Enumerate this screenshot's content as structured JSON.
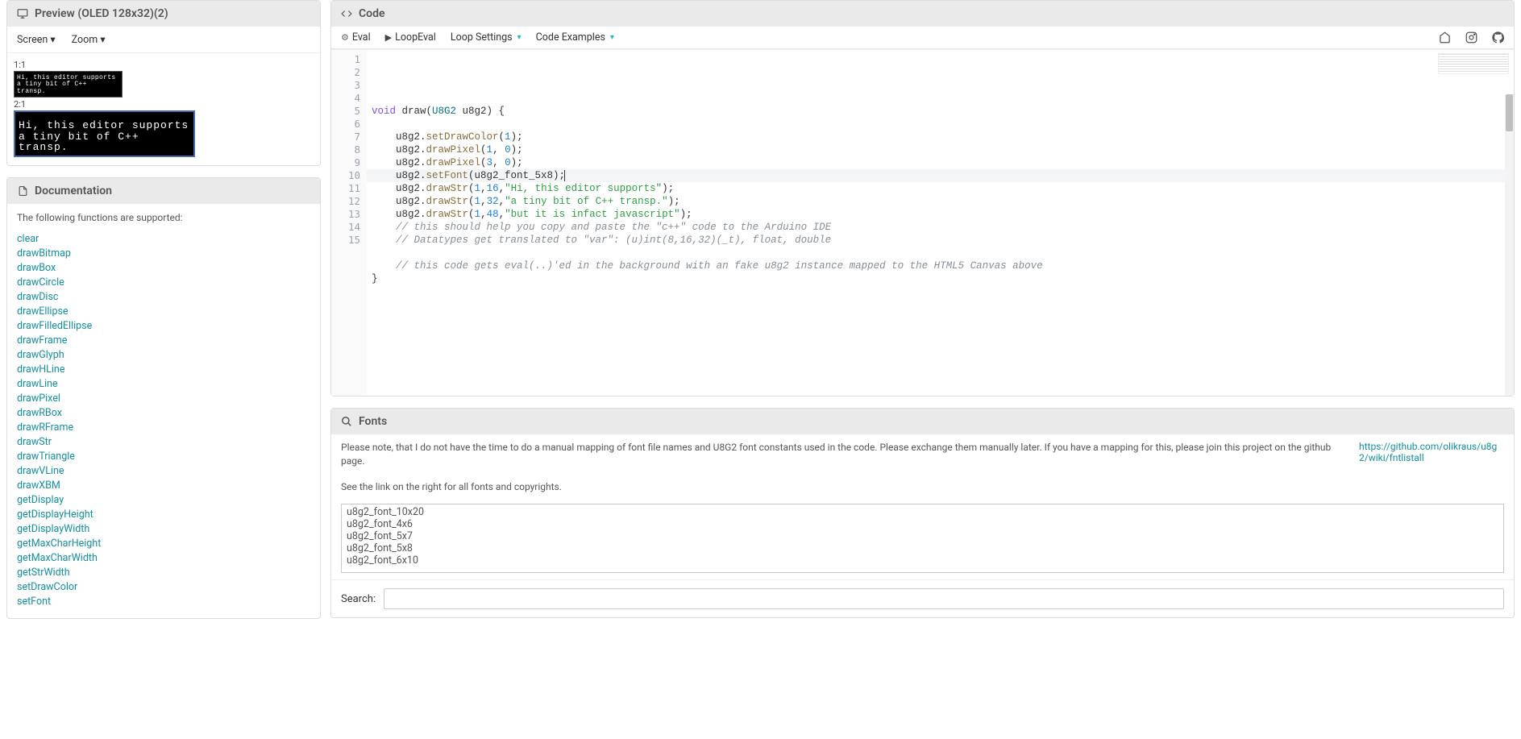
{
  "preview": {
    "title": "Preview (OLED 128x32)(2)",
    "screen_label": "Screen",
    "zoom_label": "Zoom",
    "scale1_label": "1:1",
    "scale2_label": "2:1",
    "line1": "Hi, this editor supports",
    "line2": "a tiny bit of C++ transp."
  },
  "documentation": {
    "title": "Documentation",
    "note": "The following functions are supported:",
    "items": [
      "clear",
      "drawBitmap",
      "drawBox",
      "drawCircle",
      "drawDisc",
      "drawEllipse",
      "drawFilledEllipse",
      "drawFrame",
      "drawGlyph",
      "drawHLine",
      "drawLine",
      "drawPixel",
      "drawRBox",
      "drawRFrame",
      "drawStr",
      "drawTriangle",
      "drawVLine",
      "drawXBM",
      "getDisplay",
      "getDisplayHeight",
      "getDisplayWidth",
      "getMaxCharHeight",
      "getMaxCharWidth",
      "getStrWidth",
      "setDrawColor",
      "setFont"
    ]
  },
  "code_panel": {
    "title": "Code",
    "toolbar": {
      "eval": "Eval",
      "loopeval": "LoopEval",
      "loopsettings": "Loop Settings",
      "examples": "Code Examples"
    },
    "raw_lines": [
      "",
      "void draw(U8G2 u8g2) {",
      "",
      "    u8g2.setDrawColor(1);",
      "    u8g2.drawPixel(1, 0);",
      "    u8g2.drawPixel(3, 0);",
      "    u8g2.setFont(u8g2_font_5x8);",
      "    u8g2.drawStr(1,16,\"Hi, this editor supports\");",
      "    u8g2.drawStr(1,32,\"a tiny bit of C++ transp.\");",
      "    u8g2.drawStr(1,48,\"but it is infact javascript\");",
      "    // this should help you copy and paste the \"c++\" code to the Arduino IDE",
      "    // Datatypes get translated to \"var\": (u)int(8,16,32)(_t), float, double",
      "",
      "    // this code gets eval(..)'ed in the background with an fake u8g2 instance mapped to the HTML5 Canvas above",
      "}"
    ],
    "highlight_line": 7
  },
  "fonts_panel": {
    "title": "Fonts",
    "note1": "Please note, that I do not have the time to do a manual mapping of font file names and U8G2 font constants used in the code. Please exchange them manually later. If you have a mapping for this, please join this project on the github page.",
    "note2": "See the link on the right for all fonts and copyrights.",
    "link_text": "https://github.com/olikraus/u8g2/wiki/fntlistall",
    "list": [
      "u8g2_font_10x20",
      "u8g2_font_4x6",
      "u8g2_font_5x7",
      "u8g2_font_5x8",
      "u8g2_font_6x10"
    ],
    "search_label": "Search:"
  }
}
